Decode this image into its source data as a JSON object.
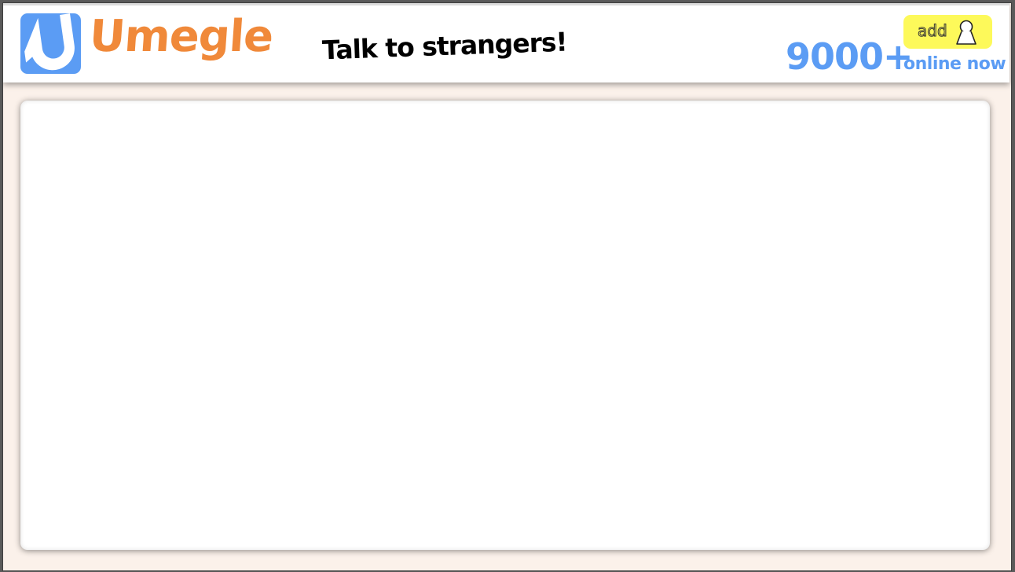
{
  "header": {
    "logo_text": "Umegle",
    "tagline": "Talk to strangers!",
    "online_count": "9000+",
    "online_label": "online now",
    "add_button_label": "add",
    "icons": {
      "logo": "u-logo-icon",
      "add_user": "user-silhouette-icon"
    }
  },
  "colors": {
    "brand_blue": "#5b9cf4",
    "brand_orange": "#f0893a",
    "add_button_bg": "#fdf95a",
    "page_bg": "#fbf1ea"
  },
  "main": {
    "content": ""
  }
}
